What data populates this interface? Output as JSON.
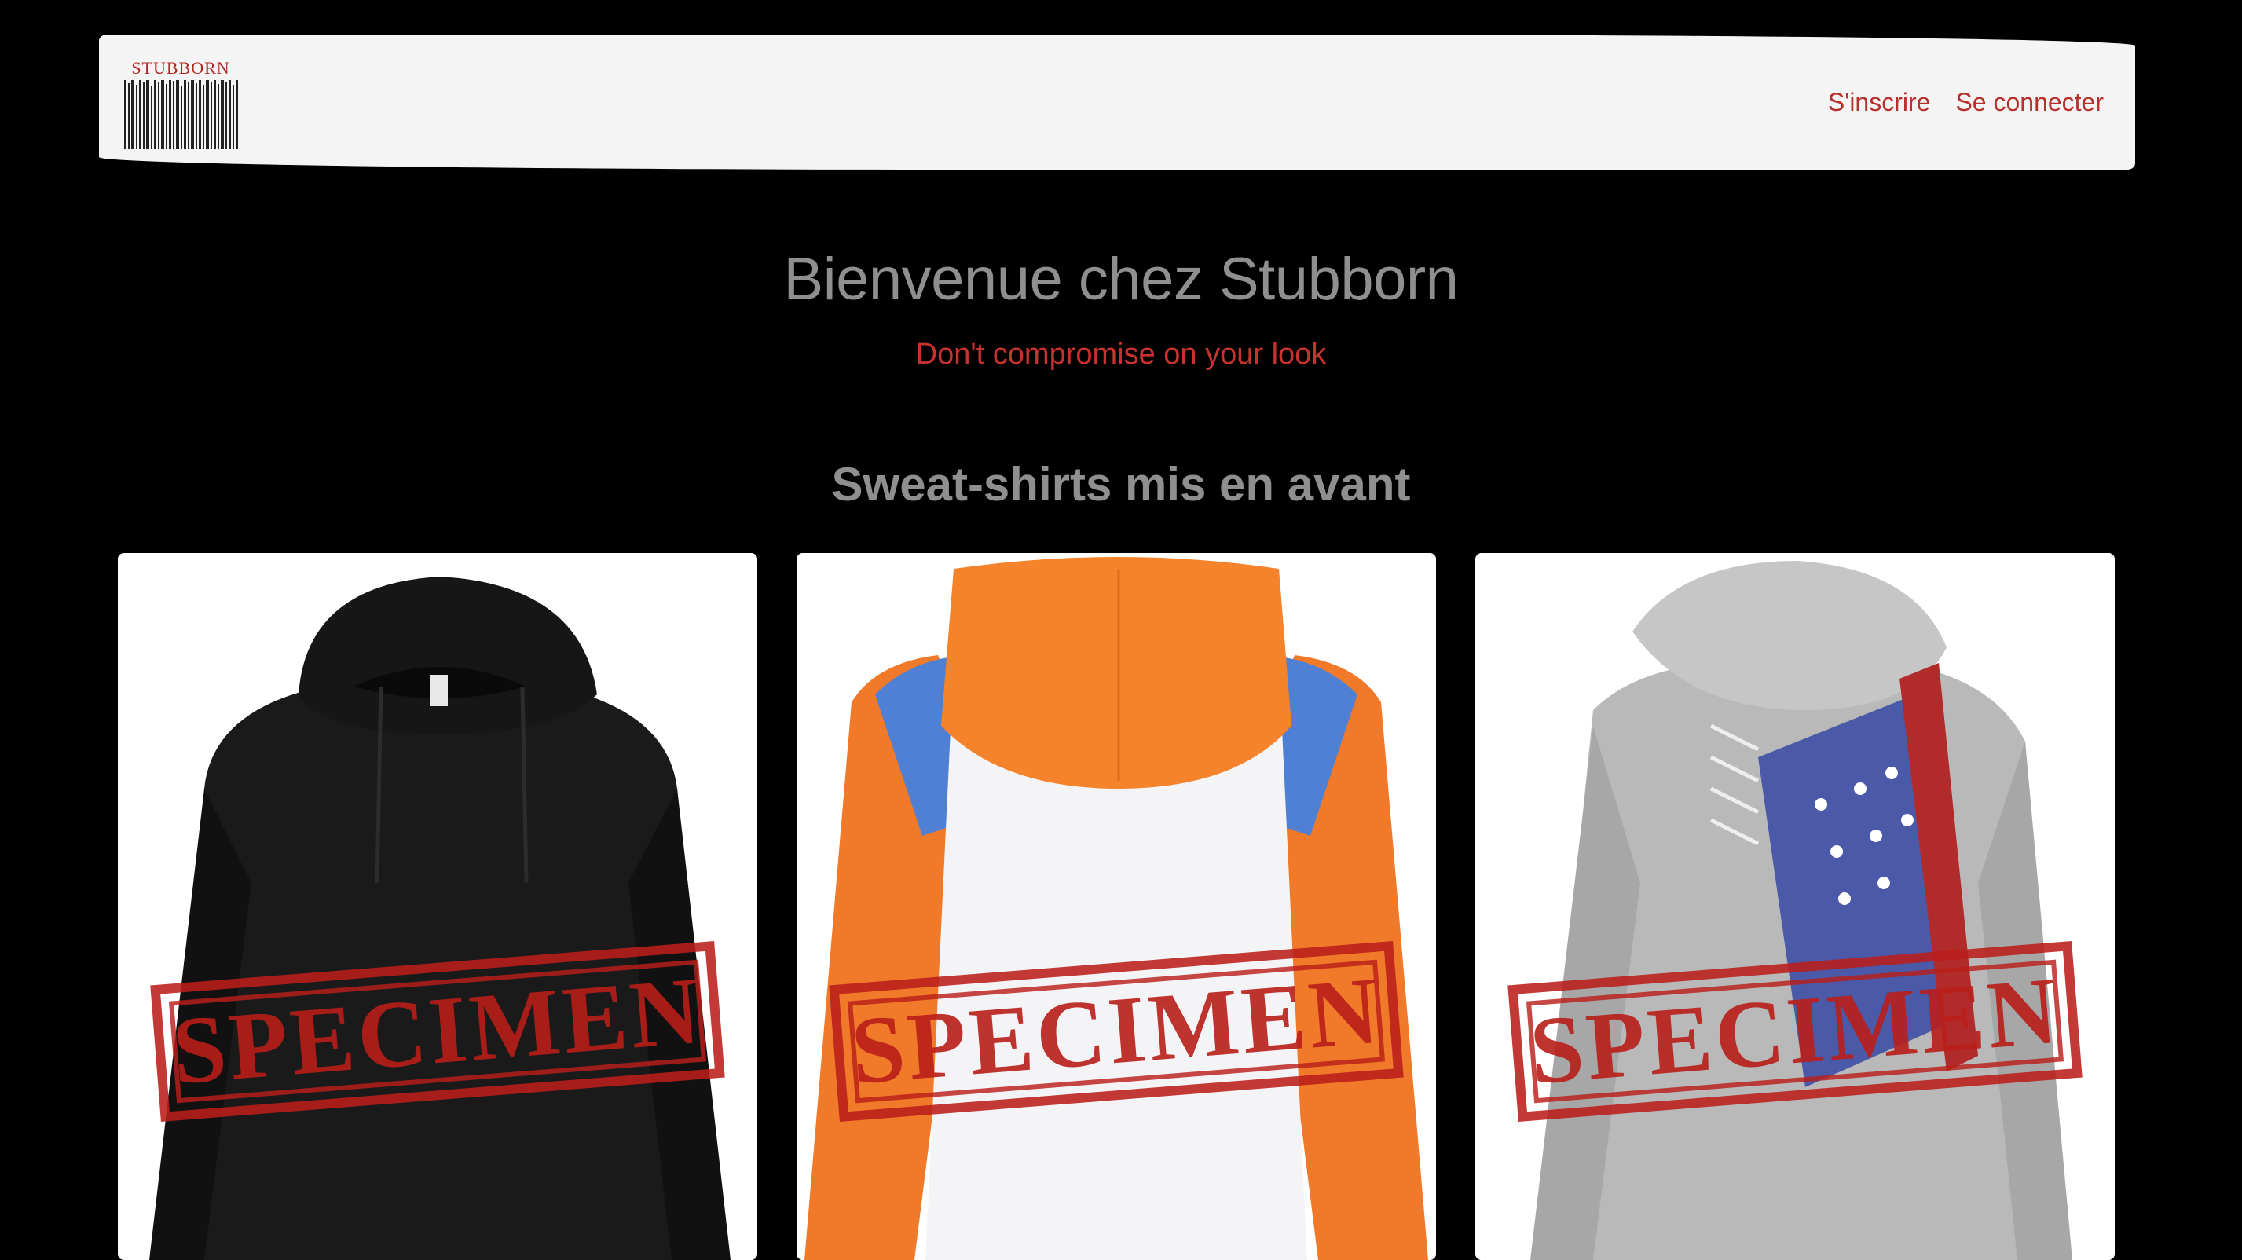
{
  "header": {
    "logo_text": "STUBBORN",
    "signup_label": "S'inscrire",
    "login_label": "Se connecter"
  },
  "hero": {
    "title": "Bienvenue chez Stubborn",
    "subtitle": "Don't compromise on your look"
  },
  "featured": {
    "title": "Sweat-shirts mis en avant",
    "products": [
      {
        "stamp": "SPECIMEN",
        "color": "black"
      },
      {
        "stamp": "SPECIMEN",
        "color": "orange-white-blue"
      },
      {
        "stamp": "SPECIMEN",
        "color": "grey-flag"
      }
    ]
  },
  "colors": {
    "background": "#000000",
    "navbar": "#f4f4f4",
    "accent": "#b8302c",
    "heading": "#8f8f8f"
  }
}
